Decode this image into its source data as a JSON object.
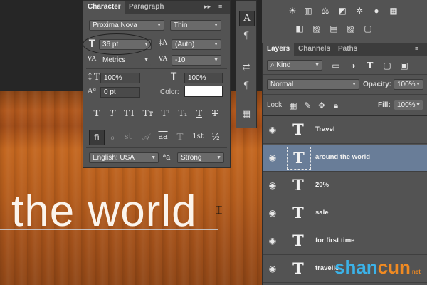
{
  "canvas": {
    "headline": "the world"
  },
  "character_panel": {
    "tabs": [
      "Character",
      "Paragraph"
    ],
    "menu_glyph": "▸▸",
    "font_family": "Proxima Nova",
    "font_style": "Thin",
    "font_size": "36 pt",
    "leading": "(Auto)",
    "kerning": "Metrics",
    "tracking": "-10",
    "vertical_scale": "100%",
    "horizontal_scale": "100%",
    "baseline_shift": "0 pt",
    "color_label": "Color:",
    "color_value": "#ffffff",
    "style_buttons": [
      "T",
      "T",
      "TT",
      "Tᴛ",
      "T¹",
      "T₁",
      "T",
      "T"
    ],
    "opentype_buttons": [
      "ﬁ",
      "ℴ",
      "st",
      "𝒜",
      "aa",
      "𝕋",
      "1st",
      "½"
    ],
    "language": "English: USA",
    "aa_label": "ªa",
    "antialias": "Strong"
  },
  "tool_strip": {
    "buttons": [
      "A",
      "¶",
      "⇄",
      "¶",
      "▦"
    ]
  },
  "layers_panel": {
    "tabs": [
      "Layers",
      "Channels",
      "Paths"
    ],
    "filter_kind": "Kind",
    "blend_mode": "Normal",
    "opacity_label": "Opacity:",
    "opacity": "100%",
    "lock_label": "Lock:",
    "fill_label": "Fill:",
    "fill": "100%",
    "layers": [
      {
        "name": "Travel",
        "selected": false
      },
      {
        "name": "around the world",
        "selected": true
      },
      {
        "name": "20%",
        "selected": false
      },
      {
        "name": "sale",
        "selected": false
      },
      {
        "name": "for first time",
        "selected": false
      },
      {
        "name": "travelle",
        "selected": false
      }
    ]
  },
  "watermark": {
    "part1": "shan",
    "part2": "cun",
    "sub": "net"
  }
}
